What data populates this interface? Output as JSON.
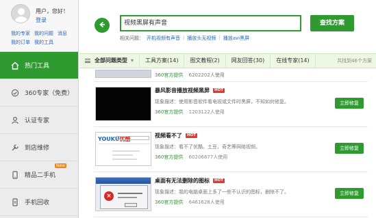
{
  "user": {
    "greeting": "用户，您好！",
    "login": "登录",
    "links_row1": [
      "我的专家",
      "我的问题",
      "消息"
    ],
    "links_row2": [
      "我的订单",
      "我的工具"
    ]
  },
  "sidebar": {
    "items": [
      {
        "label": "热门工具",
        "icon": "home-icon"
      },
      {
        "label": "360专家（免费）",
        "icon": "expert-icon"
      },
      {
        "label": "认证专家",
        "icon": "certified-user-icon"
      },
      {
        "label": "到店维修",
        "icon": "tools-icon"
      },
      {
        "label": "精品二手机",
        "icon": "phone-icon",
        "badge": "New"
      },
      {
        "label": "手机回收",
        "icon": "recycle-icon"
      }
    ]
  },
  "search": {
    "value": "视频黑屏有声音",
    "button": "查找方案",
    "related_label": "相关问题：",
    "related": [
      "开机视频有声音",
      "播放头无视频",
      "播放avi黑屏"
    ]
  },
  "tabs": {
    "all": "全部问题类型",
    "items": [
      "工具方案(14)",
      "图文教程(2)",
      "网友回答(30)",
      "在线专家(14)"
    ],
    "count": "共找到46个方案"
  },
  "results": {
    "partial_meta": {
      "source": "360官方提供",
      "uses": "6202202人使用"
    },
    "items": [
      {
        "title": "暴风影音播放视频黑屏",
        "hot": "HOT",
        "desc": "现象描述：使用影音软件看电视或文件时黑屏，不知如何修复。",
        "source": "360官方提供",
        "uses": "1203122人使用",
        "button": "立即修复",
        "thumb": "black"
      },
      {
        "title": "视频看不了",
        "hot": "HOT",
        "desc": "现象描述：看不了优酷、土豆、奇艺等网络视频。",
        "source": "360官方提供",
        "uses": "60206877人使用",
        "button": "立即修复",
        "thumb": "youku",
        "thumb_logo_main": "YOUKU",
        "thumb_logo_suffix": "优酷"
      },
      {
        "title": "桌面有无法删除的图标",
        "hot": "HOT",
        "desc": "现象描述：我的电脑桌面上多了一些不认识的图标，删除不了。",
        "source": "360官方提供",
        "uses": "6461628人使用",
        "button": "立即修复",
        "thumb": "win",
        "thumb_error_symbol": "×"
      }
    ]
  },
  "colors": {
    "accent": "#2e9a30",
    "hot": "#e23b2e",
    "link": "#2a66b8",
    "tab_bg": "#eef7e4"
  }
}
